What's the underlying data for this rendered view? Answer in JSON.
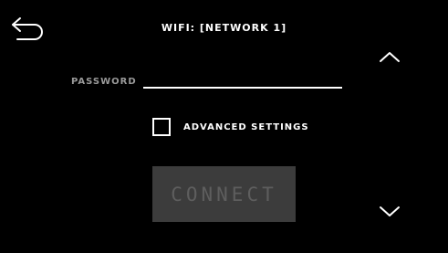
{
  "header": {
    "title": "WIFI: [NETWORK 1]",
    "back_icon": "back-arrow-icon"
  },
  "form": {
    "password_label": "PASSWORD",
    "password_value": "",
    "advanced_label": "ADVANCED SETTINGS",
    "advanced_checked": false,
    "connect_label": "CONNECT"
  },
  "nav": {
    "up_icon": "chevron-up-icon",
    "down_icon": "chevron-down-icon"
  },
  "colors": {
    "background": "#000000",
    "text": "#ffffff",
    "label_muted": "#9a9a9a",
    "button_disabled_bg": "#3c3c3c",
    "button_disabled_text": "#5e5e5e"
  }
}
